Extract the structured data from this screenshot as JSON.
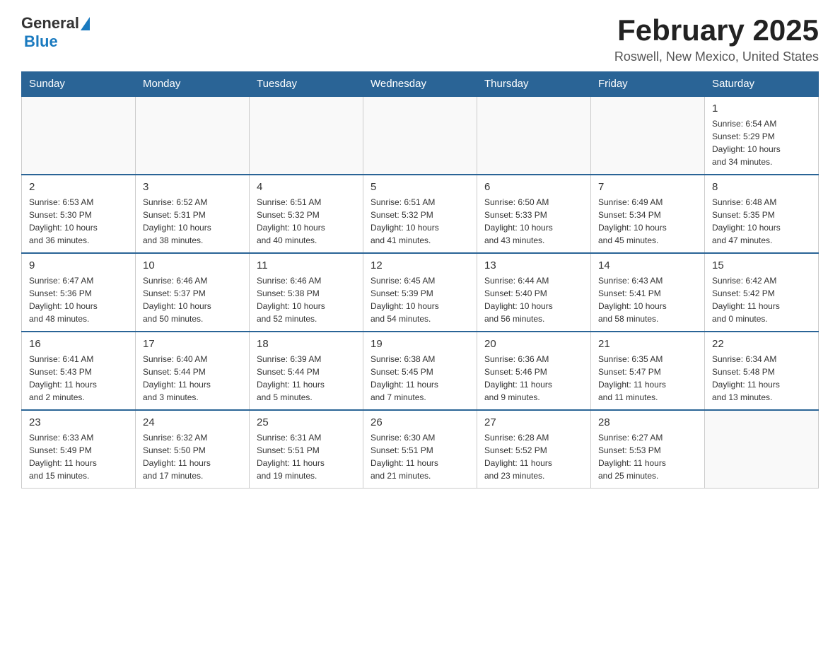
{
  "header": {
    "logo": {
      "text_general": "General",
      "text_blue": "Blue",
      "alt": "GeneralBlue logo"
    },
    "title": "February 2025",
    "location": "Roswell, New Mexico, United States"
  },
  "days_of_week": [
    "Sunday",
    "Monday",
    "Tuesday",
    "Wednesday",
    "Thursday",
    "Friday",
    "Saturday"
  ],
  "weeks": [
    {
      "days": [
        {
          "num": "",
          "info": ""
        },
        {
          "num": "",
          "info": ""
        },
        {
          "num": "",
          "info": ""
        },
        {
          "num": "",
          "info": ""
        },
        {
          "num": "",
          "info": ""
        },
        {
          "num": "",
          "info": ""
        },
        {
          "num": "1",
          "info": "Sunrise: 6:54 AM\nSunset: 5:29 PM\nDaylight: 10 hours\nand 34 minutes."
        }
      ]
    },
    {
      "days": [
        {
          "num": "2",
          "info": "Sunrise: 6:53 AM\nSunset: 5:30 PM\nDaylight: 10 hours\nand 36 minutes."
        },
        {
          "num": "3",
          "info": "Sunrise: 6:52 AM\nSunset: 5:31 PM\nDaylight: 10 hours\nand 38 minutes."
        },
        {
          "num": "4",
          "info": "Sunrise: 6:51 AM\nSunset: 5:32 PM\nDaylight: 10 hours\nand 40 minutes."
        },
        {
          "num": "5",
          "info": "Sunrise: 6:51 AM\nSunset: 5:32 PM\nDaylight: 10 hours\nand 41 minutes."
        },
        {
          "num": "6",
          "info": "Sunrise: 6:50 AM\nSunset: 5:33 PM\nDaylight: 10 hours\nand 43 minutes."
        },
        {
          "num": "7",
          "info": "Sunrise: 6:49 AM\nSunset: 5:34 PM\nDaylight: 10 hours\nand 45 minutes."
        },
        {
          "num": "8",
          "info": "Sunrise: 6:48 AM\nSunset: 5:35 PM\nDaylight: 10 hours\nand 47 minutes."
        }
      ]
    },
    {
      "days": [
        {
          "num": "9",
          "info": "Sunrise: 6:47 AM\nSunset: 5:36 PM\nDaylight: 10 hours\nand 48 minutes."
        },
        {
          "num": "10",
          "info": "Sunrise: 6:46 AM\nSunset: 5:37 PM\nDaylight: 10 hours\nand 50 minutes."
        },
        {
          "num": "11",
          "info": "Sunrise: 6:46 AM\nSunset: 5:38 PM\nDaylight: 10 hours\nand 52 minutes."
        },
        {
          "num": "12",
          "info": "Sunrise: 6:45 AM\nSunset: 5:39 PM\nDaylight: 10 hours\nand 54 minutes."
        },
        {
          "num": "13",
          "info": "Sunrise: 6:44 AM\nSunset: 5:40 PM\nDaylight: 10 hours\nand 56 minutes."
        },
        {
          "num": "14",
          "info": "Sunrise: 6:43 AM\nSunset: 5:41 PM\nDaylight: 10 hours\nand 58 minutes."
        },
        {
          "num": "15",
          "info": "Sunrise: 6:42 AM\nSunset: 5:42 PM\nDaylight: 11 hours\nand 0 minutes."
        }
      ]
    },
    {
      "days": [
        {
          "num": "16",
          "info": "Sunrise: 6:41 AM\nSunset: 5:43 PM\nDaylight: 11 hours\nand 2 minutes."
        },
        {
          "num": "17",
          "info": "Sunrise: 6:40 AM\nSunset: 5:44 PM\nDaylight: 11 hours\nand 3 minutes."
        },
        {
          "num": "18",
          "info": "Sunrise: 6:39 AM\nSunset: 5:44 PM\nDaylight: 11 hours\nand 5 minutes."
        },
        {
          "num": "19",
          "info": "Sunrise: 6:38 AM\nSunset: 5:45 PM\nDaylight: 11 hours\nand 7 minutes."
        },
        {
          "num": "20",
          "info": "Sunrise: 6:36 AM\nSunset: 5:46 PM\nDaylight: 11 hours\nand 9 minutes."
        },
        {
          "num": "21",
          "info": "Sunrise: 6:35 AM\nSunset: 5:47 PM\nDaylight: 11 hours\nand 11 minutes."
        },
        {
          "num": "22",
          "info": "Sunrise: 6:34 AM\nSunset: 5:48 PM\nDaylight: 11 hours\nand 13 minutes."
        }
      ]
    },
    {
      "days": [
        {
          "num": "23",
          "info": "Sunrise: 6:33 AM\nSunset: 5:49 PM\nDaylight: 11 hours\nand 15 minutes."
        },
        {
          "num": "24",
          "info": "Sunrise: 6:32 AM\nSunset: 5:50 PM\nDaylight: 11 hours\nand 17 minutes."
        },
        {
          "num": "25",
          "info": "Sunrise: 6:31 AM\nSunset: 5:51 PM\nDaylight: 11 hours\nand 19 minutes."
        },
        {
          "num": "26",
          "info": "Sunrise: 6:30 AM\nSunset: 5:51 PM\nDaylight: 11 hours\nand 21 minutes."
        },
        {
          "num": "27",
          "info": "Sunrise: 6:28 AM\nSunset: 5:52 PM\nDaylight: 11 hours\nand 23 minutes."
        },
        {
          "num": "28",
          "info": "Sunrise: 6:27 AM\nSunset: 5:53 PM\nDaylight: 11 hours\nand 25 minutes."
        },
        {
          "num": "",
          "info": ""
        }
      ]
    }
  ]
}
